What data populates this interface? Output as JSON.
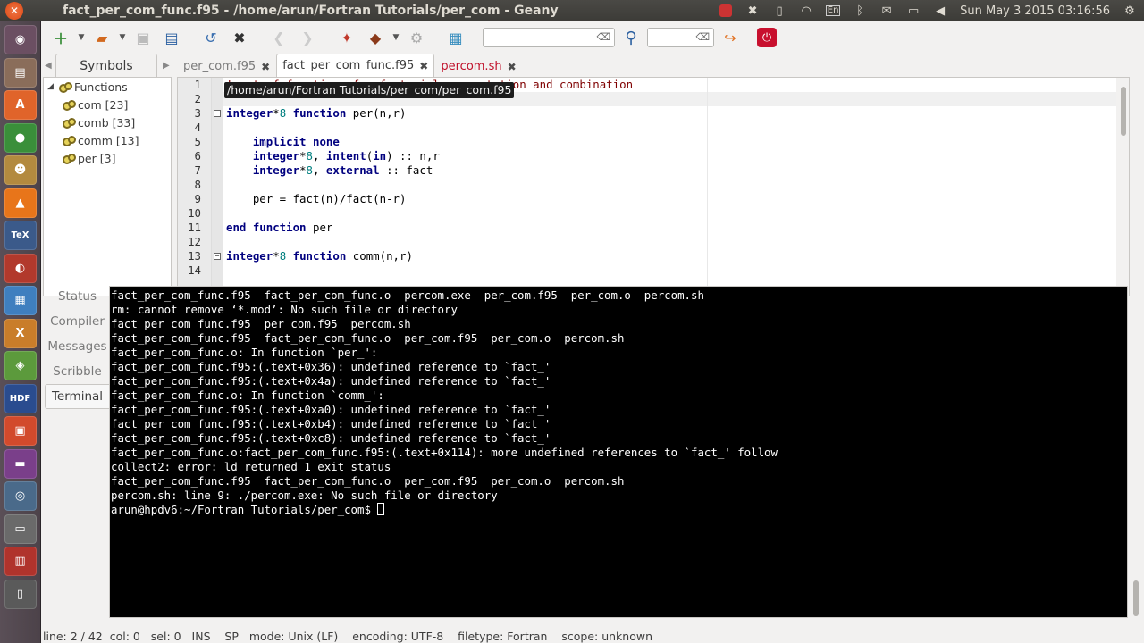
{
  "window": {
    "title": "fact_per_com_func.f95 - /home/arun/Fortran Tutorials/per_com - Geany"
  },
  "panel": {
    "clock": "Sun May 3 2015 03:16:56",
    "keyboard": "En",
    "icons": [
      "record-icon",
      "dropbox-icon",
      "clipboard-icon",
      "wifi-icon",
      "keyboard-layout-icon",
      "bluetooth-icon",
      "mail-icon",
      "battery-icon",
      "volume-icon"
    ]
  },
  "launcher": {
    "apps": [
      {
        "name": "dash-icon",
        "glyph": "◉",
        "color": "#6b4f62"
      },
      {
        "name": "files-icon",
        "glyph": "▤",
        "color": "#8a6d5a"
      },
      {
        "name": "software-center-icon",
        "glyph": "A",
        "color": "#e0642a"
      },
      {
        "name": "chrome-icon",
        "glyph": "●",
        "color": "#3a8f3a"
      },
      {
        "name": "gimp-icon",
        "glyph": "☻",
        "color": "#b38a3f"
      },
      {
        "name": "vlc-icon",
        "glyph": "▲",
        "color": "#e8751a"
      },
      {
        "name": "tex-icon",
        "glyph": "TeX",
        "color": "#3b5a8a"
      },
      {
        "name": "ubuntu-one-icon",
        "glyph": "◐",
        "color": "#b2392c"
      },
      {
        "name": "workspaces-icon",
        "glyph": "▦",
        "color": "#3f7fbf"
      },
      {
        "name": "xfig-icon",
        "glyph": "X",
        "color": "#c97d2a"
      },
      {
        "name": "geany-icon",
        "glyph": "◈",
        "color": "#5c9a3c"
      },
      {
        "name": "hdf-icon",
        "glyph": "HDF",
        "color": "#2a4c8f"
      },
      {
        "name": "impress-icon",
        "glyph": "▣",
        "color": "#d24a2c"
      },
      {
        "name": "media-icon",
        "glyph": "▬",
        "color": "#7a3f8a"
      },
      {
        "name": "disk-icon",
        "glyph": "◎",
        "color": "#4a6a8a"
      },
      {
        "name": "usb-drive-icon",
        "glyph": "▭",
        "color": "#6a6a6a"
      },
      {
        "name": "trash-drive-icon",
        "glyph": "▥",
        "color": "#b0332c"
      },
      {
        "name": "printer-icon",
        "glyph": "▯",
        "color": "#5a5a5a"
      }
    ]
  },
  "sidebar": {
    "tab_label": "Symbols",
    "root_label": "Functions",
    "symbols": [
      "com [23]",
      "comb [33]",
      "comm [13]",
      "per [3]"
    ]
  },
  "editor": {
    "tabs": [
      {
        "label": "per_com.f95",
        "state": "inactive"
      },
      {
        "label": "fact_per_com_func.f95",
        "state": "active"
      },
      {
        "label": "percom.sh",
        "state": "modified"
      }
    ],
    "tooltip": "/home/arun/Fortran Tutorials/per_com/per_com.f95",
    "line_numbers": [
      "1",
      "2",
      "3",
      "4",
      "5",
      "6",
      "7",
      "8",
      "9",
      "10",
      "11",
      "12",
      "13",
      "14"
    ],
    "line1_comment_visible": "! set of functions for factorial, permutation and combination"
  },
  "messages": {
    "tabs": [
      "Status",
      "Compiler",
      "Messages",
      "Scribble",
      "Terminal"
    ],
    "active_tab": "Terminal",
    "terminal_lines": [
      "fact_per_com_func.f95  fact_per_com_func.o  percom.exe  per_com.f95  per_com.o  percom.sh",
      "rm: cannot remove ‘*.mod’: No such file or directory",
      "fact_per_com_func.f95  per_com.f95  percom.sh",
      "fact_per_com_func.f95  fact_per_com_func.o  per_com.f95  per_com.o  percom.sh",
      "fact_per_com_func.o: In function `per_':",
      "fact_per_com_func.f95:(.text+0x36): undefined reference to `fact_'",
      "fact_per_com_func.f95:(.text+0x4a): undefined reference to `fact_'",
      "fact_per_com_func.o: In function `comm_':",
      "fact_per_com_func.f95:(.text+0xa0): undefined reference to `fact_'",
      "fact_per_com_func.f95:(.text+0xb4): undefined reference to `fact_'",
      "fact_per_com_func.f95:(.text+0xc8): undefined reference to `fact_'",
      "fact_per_com_func.o:fact_per_com_func.f95:(.text+0x114): more undefined references to `fact_' follow",
      "collect2: error: ld returned 1 exit status",
      "fact_per_com_func.f95  fact_per_com_func.o  per_com.f95  per_com.o  percom.sh",
      "percom.sh: line 9: ./percom.exe: No such file or directory"
    ],
    "prompt": "arun@hpdv6:~/Fortran Tutorials/per_com$ "
  },
  "statusbar": {
    "line": "line: 2 / 42",
    "col": "col: 0",
    "sel": "sel: 0",
    "ins": "INS",
    "sp": "SP",
    "mode": "mode: Unix (LF)",
    "encoding": "encoding: UTF-8",
    "filetype": "filetype: Fortran",
    "scope": "scope: unknown"
  }
}
